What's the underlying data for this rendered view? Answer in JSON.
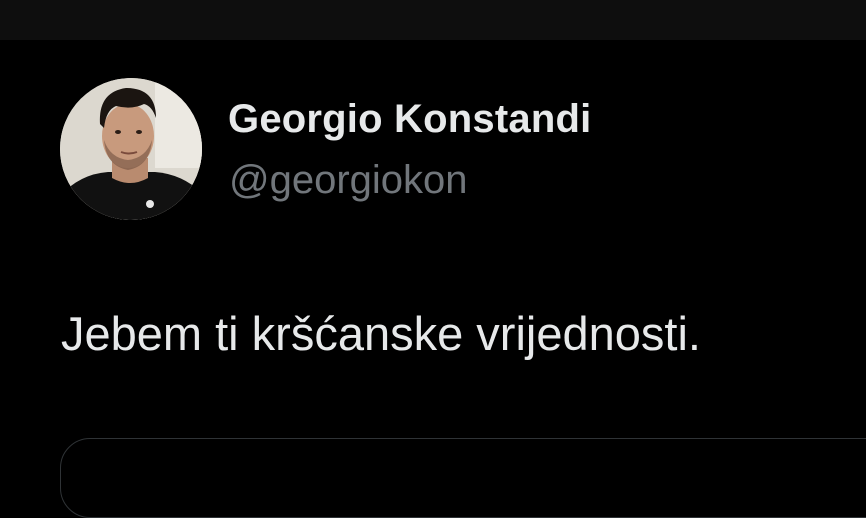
{
  "author": {
    "name": "Georgio Konstandi",
    "handle": "@georgiokon",
    "avatar_icon": "profile-photo"
  },
  "tweet": {
    "text": "Jebem ti kršćanske vrijednosti."
  },
  "colors": {
    "background": "#000000",
    "text_primary": "#e7e9ea",
    "text_secondary": "#71767b",
    "border": "#2f3336"
  }
}
